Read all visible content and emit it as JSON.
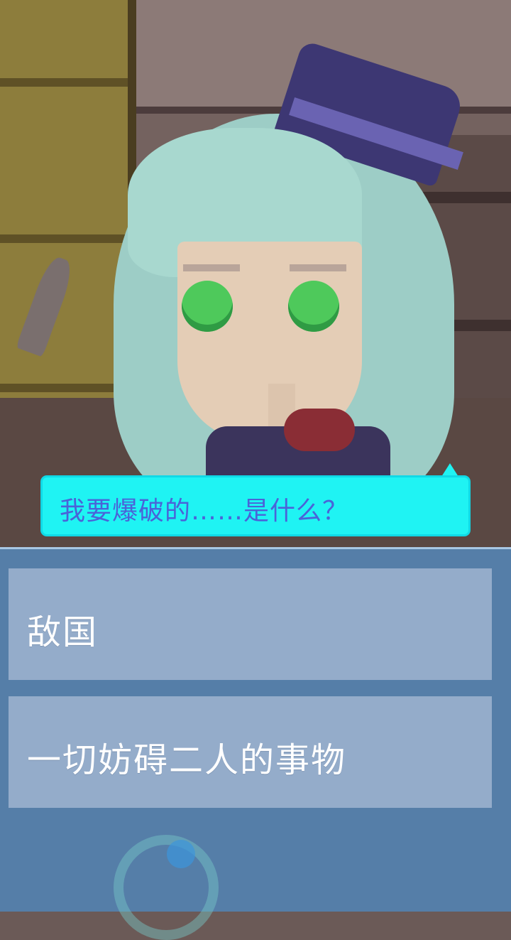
{
  "dialogue": {
    "line": "我要爆破的……是什么？"
  },
  "choices": [
    {
      "label": "敌国"
    },
    {
      "label": "一切妨碍二人的事物"
    }
  ],
  "colors": {
    "speech_bubble": "#1ff3f3",
    "speech_text": "#4a63d8",
    "choice_panel": "#4c8cc8",
    "choice_button": "#c8d2e6",
    "choice_text": "#ffffff"
  }
}
